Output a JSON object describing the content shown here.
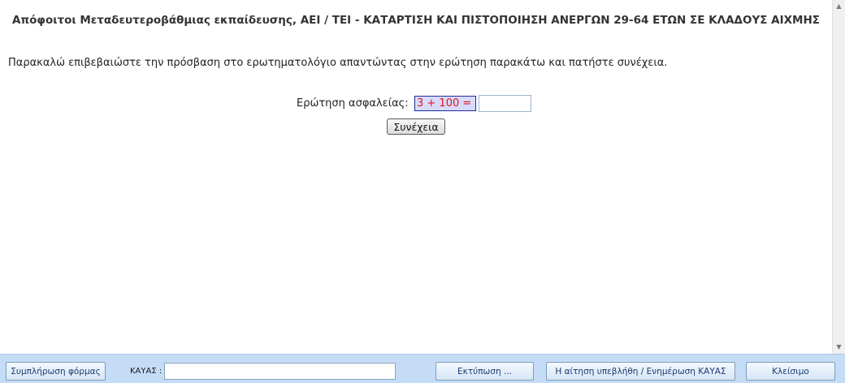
{
  "page": {
    "title": "Απόφοιτοι Μεταδευτεροβάθμιας εκπαίδευσης, ΑΕΙ / ΤΕΙ - ΚΑΤΑΡΤΙΣΗ ΚΑΙ ΠΙΣΤΟΠΟΙΗΣΗ ΑΝΕΡΓΩΝ 29-64 ΕΤΩΝ ΣΕ ΚΛΑΔΟΥΣ ΑΙΧΜΗΣ",
    "instructions": "Παρακαλώ επιβεβαιώστε την πρόσβαση στο ερωτηματολόγιο απαντώντας στην ερώτηση παρακάτω και πατήστε συνέχεια."
  },
  "security": {
    "label": "Ερώτηση ασφαλείας:",
    "question": "3 + 100 =",
    "answer": "",
    "continue_label": "Συνέχεια"
  },
  "footer": {
    "fill_form_label": "Συμπλήρωση φόρμας",
    "kayas_label": "ΚΑΥΑΣ :",
    "kayas_value": "",
    "print_label": "Εκτύπωση ...",
    "submitted_label": "Η αίτηση υπεβλήθη / Ενημέρωση ΚΑΥΑΣ",
    "close_label": "Κλείσιμο"
  },
  "icons": {
    "scroll_up": "scroll-up-arrow-icon",
    "scroll_down": "scroll-down-arrow-icon"
  },
  "colors": {
    "captcha_text": "#e01818",
    "captcha_bg": "#d6dbff",
    "footer_bg": "#c5dcf6"
  }
}
